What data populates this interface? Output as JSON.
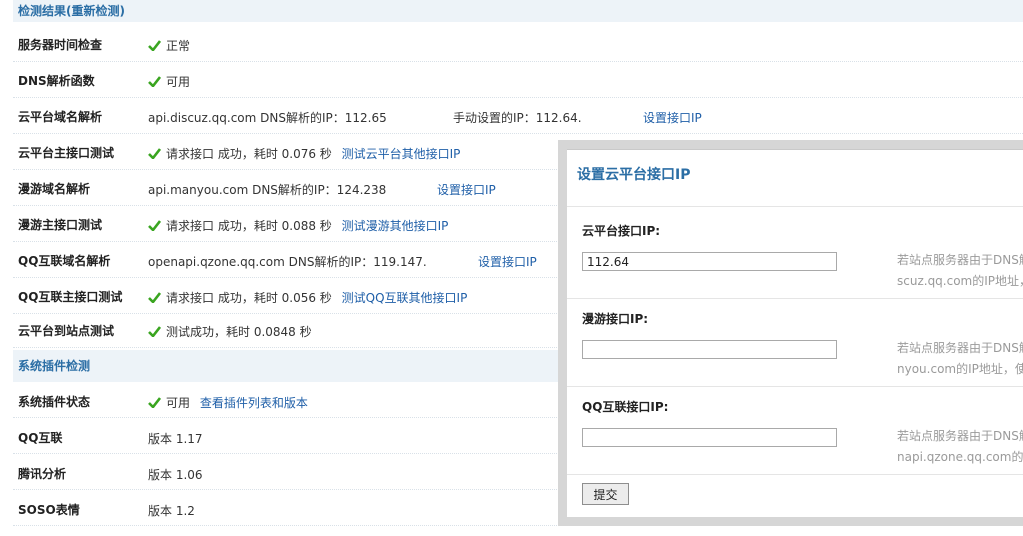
{
  "section1": {
    "title": "检测结果(重新检测)"
  },
  "rows": [
    {
      "label": "服务器时间检查",
      "status": "正常"
    },
    {
      "label": "DNS解析函数",
      "status": "可用"
    },
    {
      "label": "云平台域名解析",
      "domain_text": "api.discuz.qq.com DNS解析的IP：112.65",
      "manual_text": "手动设置的IP：112.64.",
      "link": "设置接口IP"
    },
    {
      "label": "云平台主接口测试",
      "text": "请求接口 成功，耗时 0.076 秒",
      "link": "测试云平台其他接口IP"
    },
    {
      "label": "漫游域名解析",
      "domain_text": "api.manyou.com DNS解析的IP：124.238",
      "link": "设置接口IP"
    },
    {
      "label": "漫游主接口测试",
      "text": "请求接口 成功，耗时 0.088 秒",
      "link": "测试漫游其他接口IP"
    },
    {
      "label": "QQ互联域名解析",
      "domain_text": "openapi.qzone.qq.com DNS解析的IP：119.147.",
      "link": "设置接口IP"
    },
    {
      "label": "QQ互联主接口测试",
      "text": "请求接口 成功，耗时 0.056 秒",
      "link": "测试QQ互联其他接口IP"
    },
    {
      "label": "云平台到站点测试",
      "text": "测试成功，耗时 0.0848 秒"
    }
  ],
  "section2": {
    "title": "系统插件检测"
  },
  "plugin_rows": [
    {
      "label": "系统插件状态",
      "status": "可用",
      "link": "查看插件列表和版本"
    },
    {
      "label": "QQ互联",
      "version": "版本 1.17"
    },
    {
      "label": "腾讯分析",
      "version": "版本 1.06"
    },
    {
      "label": "SOSO表情",
      "version": "版本 1.2"
    }
  ],
  "popup": {
    "title": "设置云平台接口IP",
    "fields": [
      {
        "label": "云平台接口IP:",
        "value": "112.64",
        "hint1": "若站点服务器由于DNS解",
        "hint2": "scuz.qq.com的IP地址，"
      },
      {
        "label": "漫游接口IP:",
        "value": "",
        "hint1": "若站点服务器由于DNS解",
        "hint2": "nyou.com的IP地址，使"
      },
      {
        "label": "QQ互联接口IP:",
        "value": "",
        "hint1": "若站点服务器由于DNS解",
        "hint2": "napi.qzone.qq.com的"
      }
    ],
    "submit_label": "提交"
  },
  "colors": {
    "accent": "#2b6ea5",
    "check": "#3aa520",
    "link": "#1f5fa8",
    "header_bg": "#edf3f8"
  }
}
